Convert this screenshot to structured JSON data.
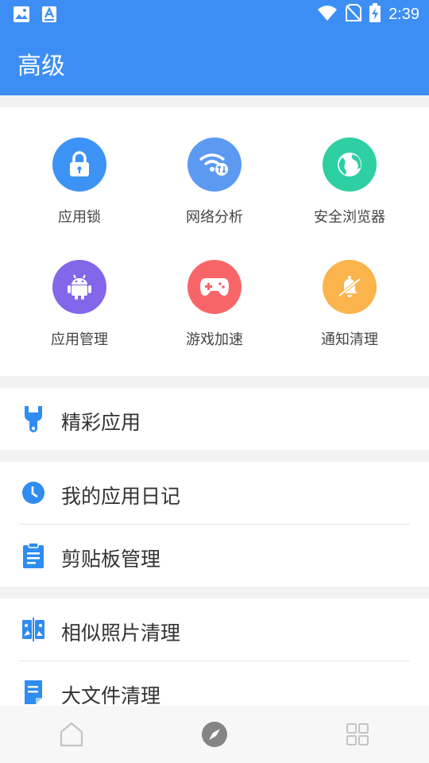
{
  "status_bar": {
    "time": "2:39",
    "icons": [
      "image-icon",
      "text-a-icon",
      "wifi-icon",
      "no-sim-icon",
      "battery-charging-icon"
    ]
  },
  "header": {
    "title": "高级"
  },
  "tools": [
    {
      "label": "应用锁",
      "icon": "lock-icon",
      "color": "#3d93f5"
    },
    {
      "label": "网络分析",
      "icon": "wifi-analysis-icon",
      "color": "#5c9af2"
    },
    {
      "label": "安全浏览器",
      "icon": "globe-icon",
      "color": "#2ecfa3"
    },
    {
      "label": "应用管理",
      "icon": "android-icon",
      "color": "#8366ea"
    },
    {
      "label": "游戏加速",
      "icon": "gamepad-icon",
      "color": "#f86568"
    },
    {
      "label": "通知清理",
      "icon": "bell-off-icon",
      "color": "#fbb34b"
    }
  ],
  "list": {
    "featured_apps": "精彩应用",
    "app_diary": "我的应用日记",
    "clipboard": "剪贴板管理",
    "similar_photos": "相似照片清理",
    "large_files": "大文件清理"
  },
  "colors": {
    "accent": "#3d8ef4",
    "icon_blue": "#2f8cf0"
  },
  "bottom_nav": [
    "home-icon",
    "compass-icon",
    "grid-icon"
  ]
}
